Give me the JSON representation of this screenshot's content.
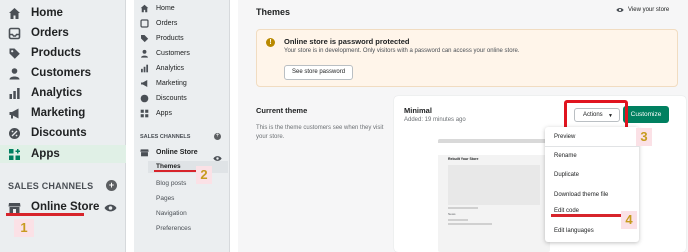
{
  "nav_large": {
    "items": [
      {
        "label": "Home",
        "icon": "home-icon"
      },
      {
        "label": "Orders",
        "icon": "orders-icon"
      },
      {
        "label": "Products",
        "icon": "tag-icon"
      },
      {
        "label": "Customers",
        "icon": "person-icon"
      },
      {
        "label": "Analytics",
        "icon": "bar-chart-icon"
      },
      {
        "label": "Marketing",
        "icon": "megaphone-icon"
      },
      {
        "label": "Discounts",
        "icon": "discount-icon"
      },
      {
        "label": "Apps",
        "icon": "apps-icon"
      }
    ],
    "section": "SALES CHANNELS",
    "online_store": "Online Store",
    "step_label": "1"
  },
  "nav_small": {
    "items": [
      {
        "label": "Home"
      },
      {
        "label": "Orders"
      },
      {
        "label": "Products"
      },
      {
        "label": "Customers"
      },
      {
        "label": "Analytics"
      },
      {
        "label": "Marketing"
      },
      {
        "label": "Discounts"
      },
      {
        "label": "Apps"
      }
    ],
    "section": "SALES CHANNELS",
    "online_store": "Online Store",
    "sub_items": [
      "Themes",
      "Blog posts",
      "Pages",
      "Navigation",
      "Preferences"
    ],
    "step_label": "2"
  },
  "main": {
    "title": "Themes",
    "view_store": "View your store",
    "banner": {
      "heading": "Online store is password protected",
      "text": "Your store is in development. Only visitors with a password can access your online store.",
      "button": "See store password"
    },
    "current_theme": {
      "title": "Current theme",
      "description": "This is the theme customers see when they visit your store."
    },
    "theme_card": {
      "name": "Minimal",
      "saved": "Added: 19 minutes ago",
      "actions_label": "Actions",
      "customize_label": "Customize",
      "preview_heading": "Rebuilt Your Store",
      "preview_news": "News"
    },
    "actions_menu": [
      "Preview",
      "Rename",
      "Duplicate",
      "Download theme file",
      "Edit code",
      "Edit languages"
    ],
    "step3_label": "3",
    "step4_label": "4"
  },
  "colors": {
    "accent_green": "#008060",
    "annotation_red": "#e0141f",
    "banner_bg": "#fff5ea",
    "step_number": "#c79b1e"
  }
}
